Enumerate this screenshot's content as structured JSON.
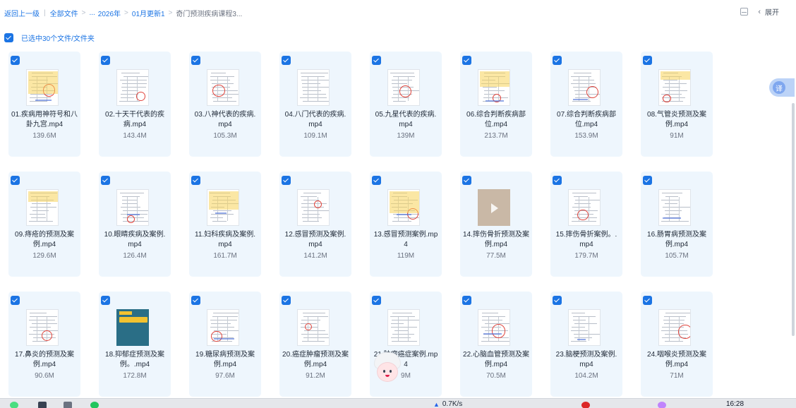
{
  "breadcrumb": {
    "back": "返回上一级",
    "all_files": "全部文件",
    "ellipsis": "...",
    "year": "2026年",
    "month": "01月更新1",
    "current": "奇门预测疾病课程3..."
  },
  "header": {
    "expand_label": "展开"
  },
  "selection": {
    "label": "已选中30个文件/文件夹"
  },
  "translate": {
    "label": "译"
  },
  "files": [
    {
      "name": "01.疾病用神符号和八卦九宫.mp4",
      "size": "139.6M",
      "thumb": "doc"
    },
    {
      "name": "02.十天干代表的疾病.mp4",
      "size": "143.4M",
      "thumb": "doc"
    },
    {
      "name": "03.八神代表的疾病.mp4",
      "size": "105.3M",
      "thumb": "doc"
    },
    {
      "name": "04.八门代表的疾病.mp4",
      "size": "109.1M",
      "thumb": "doc"
    },
    {
      "name": "05.九星代表的疾病.mp4",
      "size": "139M",
      "thumb": "doc"
    },
    {
      "name": "06.综合判断疾病部位.mp4",
      "size": "213.7M",
      "thumb": "doc"
    },
    {
      "name": "07.综合判断疾病部位.mp4",
      "size": "153.9M",
      "thumb": "doc"
    },
    {
      "name": "08.气管炎预测及案例.mp4",
      "size": "91M",
      "thumb": "doc"
    },
    {
      "name": "09.痔疮的预测及案例.mp4",
      "size": "129.6M",
      "thumb": "doc"
    },
    {
      "name": "10.眼睛疾病及案例.mp4",
      "size": "126.4M",
      "thumb": "doc"
    },
    {
      "name": "11.妇科疾病及案例.mp4",
      "size": "161.7M",
      "thumb": "doc"
    },
    {
      "name": "12.感冒预测及案例.mp4",
      "size": "141.2M",
      "thumb": "doc"
    },
    {
      "name": "13.感冒预测案例.mp4",
      "size": "119M",
      "thumb": "doc"
    },
    {
      "name": "14.摔伤骨折预测及案例.mp4",
      "size": "77.5M",
      "thumb": "photo"
    },
    {
      "name": "15.摔伤骨折案例。.mp4",
      "size": "179.7M",
      "thumb": "doc"
    },
    {
      "name": "16.肠胃病预测及案例.mp4",
      "size": "105.7M",
      "thumb": "doc"
    },
    {
      "name": "17.鼻炎的预测及案例.mp4",
      "size": "90.6M",
      "thumb": "doc"
    },
    {
      "name": "18.抑郁症预测及案例。.mp4",
      "size": "172.8M",
      "thumb": "dark"
    },
    {
      "name": "19.糖尿病预测及案例.mp4",
      "size": "97.6M",
      "thumb": "doc"
    },
    {
      "name": "20.癌症肿瘤预测及案例.mp4",
      "size": "91.2M",
      "thumb": "doc"
    },
    {
      "name": "21.肿瘤癌症案例.mp4",
      "size": "9M",
      "thumb": "doc"
    },
    {
      "name": "22.心脑血管预测及案例.mp4",
      "size": "70.5M",
      "thumb": "doc"
    },
    {
      "name": "23.脑梗预测及案例.mp4",
      "size": "104.2M",
      "thumb": "doc"
    },
    {
      "name": "24.咽喉炎预测及案例.mp4",
      "size": "71M",
      "thumb": "doc"
    }
  ],
  "taskbar": {
    "net_speed": "0.7K/s",
    "time": "16:28"
  },
  "colors": {
    "accent": "#1b74e4",
    "card_bg": "#eef6fd"
  }
}
